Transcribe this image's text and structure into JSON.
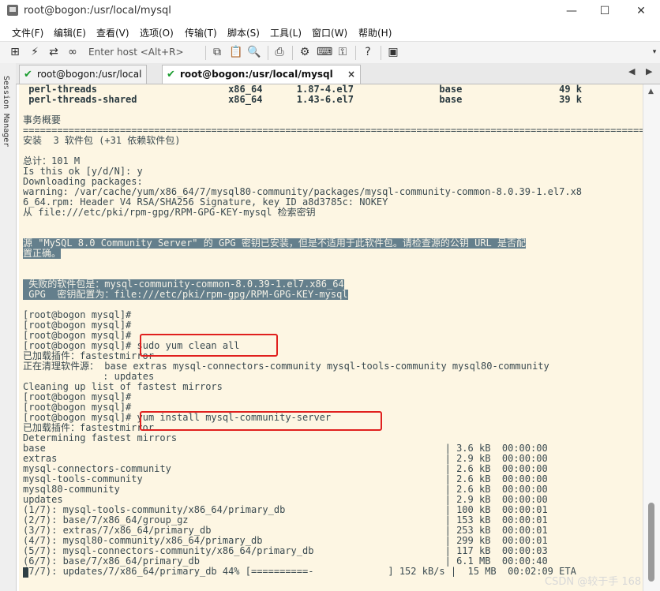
{
  "window": {
    "title": "root@bogon:/usr/local/mysql",
    "minimize": "—",
    "maximize": "☐",
    "close": "✕"
  },
  "menu": [
    "文件(F)",
    "编辑(E)",
    "查看(V)",
    "选项(O)",
    "传输(T)",
    "脚本(S)",
    "工具(L)",
    "窗口(W)",
    "帮助(H)"
  ],
  "toolbar": {
    "host_placeholder": "Enter host <Alt+R>"
  },
  "sidebar": {
    "label": "Session Manager"
  },
  "tabs": [
    {
      "label": "root@bogon:/usr/local",
      "active": false
    },
    {
      "label": "root@bogon:/usr/local/mysql",
      "active": true
    }
  ],
  "tabs_close": "×",
  "terminal": {
    "lines": [
      {
        "text": " perl-threads                       x86_64      1.87-4.el7               base                 49 k",
        "bold": true
      },
      {
        "text": " perl-threads-shared                x86_64      1.43-6.el7               base                 39 k",
        "bold": true
      },
      {
        "text": ""
      },
      {
        "text": "事务概要"
      },
      {
        "text": "==================================================================================================================="
      },
      {
        "text": "安装  3 软件包 (+31 依赖软件包)"
      },
      {
        "text": ""
      },
      {
        "text": "总计：101 M"
      },
      {
        "text": "Is this ok [y/d/N]: y"
      },
      {
        "text": "Downloading packages:"
      },
      {
        "text": "warning: /var/cache/yum/x86_64/7/mysql80-community/packages/mysql-community-common-8.0.39-1.el7.x8"
      },
      {
        "text": "6_64.rpm: Header V4 RSA/SHA256 Signature, key ID a8d3785c: NOKEY"
      },
      {
        "text": "从 file:///etc/pki/rpm-gpg/RPM-GPG-KEY-mysql 检索密钥"
      },
      {
        "text": ""
      },
      {
        "text": ""
      },
      {
        "text": "源 \"MySQL 8.0 Community Server\" 的 GPG 密钥已安装，但是不适用于此软件包。请检查源的公钥 URL 是否配",
        "highlight": true
      },
      {
        "text": "置正确。",
        "highlight": true
      },
      {
        "text": ""
      },
      {
        "text": ""
      },
      {
        "text": " 失败的软件包是：mysql-community-common-8.0.39-1.el7.x86_64",
        "highlight": true
      },
      {
        "text": " GPG  密钥配置为：file:///etc/pki/rpm-gpg/RPM-GPG-KEY-mysql",
        "highlight": true
      },
      {
        "text": ""
      },
      {
        "text": "[root@bogon mysql]#"
      },
      {
        "text": "[root@bogon mysql]#"
      },
      {
        "text": "[root@bogon mysql]#"
      },
      {
        "text": "[root@bogon mysql]# sudo yum clean all"
      },
      {
        "text": "已加载插件：fastestmirror"
      },
      {
        "text": "正在清理软件源： base extras mysql-connectors-community mysql-tools-community mysql80-community"
      },
      {
        "text": "              : updates"
      },
      {
        "text": "Cleaning up list of fastest mirrors"
      },
      {
        "text": "[root@bogon mysql]#"
      },
      {
        "text": "[root@bogon mysql]#"
      },
      {
        "text": "[root@bogon mysql]# yum install mysql-community-server"
      },
      {
        "text": "已加载插件：fastestmirror"
      },
      {
        "text": "Determining fastest mirrors"
      },
      {
        "text": "base                                                                      | 3.6 kB  00:00:00"
      },
      {
        "text": "extras                                                                    | 2.9 kB  00:00:00"
      },
      {
        "text": "mysql-connectors-community                                                | 2.6 kB  00:00:00"
      },
      {
        "text": "mysql-tools-community                                                     | 2.6 kB  00:00:00"
      },
      {
        "text": "mysql80-community                                                         | 2.6 kB  00:00:00"
      },
      {
        "text": "updates                                                                   | 2.9 kB  00:00:00"
      },
      {
        "text": "(1/7): mysql-tools-community/x86_64/primary_db                            | 100 kB  00:00:01"
      },
      {
        "text": "(2/7): base/7/x86_64/group_gz                                             | 153 kB  00:00:01"
      },
      {
        "text": "(3/7): extras/7/x86_64/primary_db                                         | 253 kB  00:00:01"
      },
      {
        "text": "(4/7): mysql80-community/x86_64/primary_db                                | 299 kB  00:00:01"
      },
      {
        "text": "(5/7): mysql-connectors-community/x86_64/primary_db                       | 117 kB  00:00:03"
      },
      {
        "text": "(6/7): base/7/x86_64/primary_db                                           | 6.1 MB  00:00:40"
      },
      {
        "text": "(7/7): updates/7/x86_64/primary_db 44% [==========-             ] 152 kB/s |  15 MB  00:02:09 ETA"
      }
    ]
  },
  "watermark": "CSDN @较于手 168"
}
